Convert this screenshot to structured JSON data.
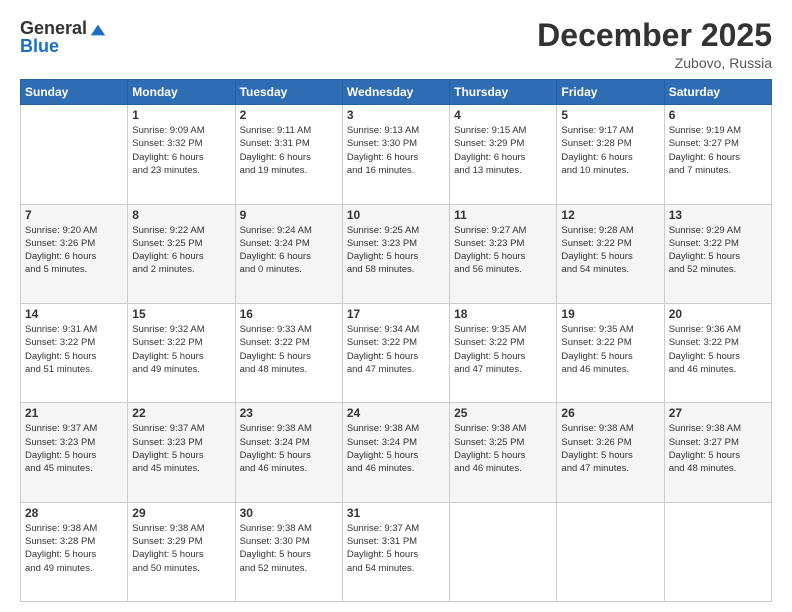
{
  "header": {
    "logo_general": "General",
    "logo_blue": "Blue",
    "month": "December 2025",
    "location": "Zubovo, Russia"
  },
  "days_of_week": [
    "Sunday",
    "Monday",
    "Tuesday",
    "Wednesday",
    "Thursday",
    "Friday",
    "Saturday"
  ],
  "weeks": [
    [
      {
        "day": "",
        "info": ""
      },
      {
        "day": "1",
        "info": "Sunrise: 9:09 AM\nSunset: 3:32 PM\nDaylight: 6 hours\nand 23 minutes."
      },
      {
        "day": "2",
        "info": "Sunrise: 9:11 AM\nSunset: 3:31 PM\nDaylight: 6 hours\nand 19 minutes."
      },
      {
        "day": "3",
        "info": "Sunrise: 9:13 AM\nSunset: 3:30 PM\nDaylight: 6 hours\nand 16 minutes."
      },
      {
        "day": "4",
        "info": "Sunrise: 9:15 AM\nSunset: 3:29 PM\nDaylight: 6 hours\nand 13 minutes."
      },
      {
        "day": "5",
        "info": "Sunrise: 9:17 AM\nSunset: 3:28 PM\nDaylight: 6 hours\nand 10 minutes."
      },
      {
        "day": "6",
        "info": "Sunrise: 9:19 AM\nSunset: 3:27 PM\nDaylight: 6 hours\nand 7 minutes."
      }
    ],
    [
      {
        "day": "7",
        "info": "Sunrise: 9:20 AM\nSunset: 3:26 PM\nDaylight: 6 hours\nand 5 minutes."
      },
      {
        "day": "8",
        "info": "Sunrise: 9:22 AM\nSunset: 3:25 PM\nDaylight: 6 hours\nand 2 minutes."
      },
      {
        "day": "9",
        "info": "Sunrise: 9:24 AM\nSunset: 3:24 PM\nDaylight: 6 hours\nand 0 minutes."
      },
      {
        "day": "10",
        "info": "Sunrise: 9:25 AM\nSunset: 3:23 PM\nDaylight: 5 hours\nand 58 minutes."
      },
      {
        "day": "11",
        "info": "Sunrise: 9:27 AM\nSunset: 3:23 PM\nDaylight: 5 hours\nand 56 minutes."
      },
      {
        "day": "12",
        "info": "Sunrise: 9:28 AM\nSunset: 3:22 PM\nDaylight: 5 hours\nand 54 minutes."
      },
      {
        "day": "13",
        "info": "Sunrise: 9:29 AM\nSunset: 3:22 PM\nDaylight: 5 hours\nand 52 minutes."
      }
    ],
    [
      {
        "day": "14",
        "info": "Sunrise: 9:31 AM\nSunset: 3:22 PM\nDaylight: 5 hours\nand 51 minutes."
      },
      {
        "day": "15",
        "info": "Sunrise: 9:32 AM\nSunset: 3:22 PM\nDaylight: 5 hours\nand 49 minutes."
      },
      {
        "day": "16",
        "info": "Sunrise: 9:33 AM\nSunset: 3:22 PM\nDaylight: 5 hours\nand 48 minutes."
      },
      {
        "day": "17",
        "info": "Sunrise: 9:34 AM\nSunset: 3:22 PM\nDaylight: 5 hours\nand 47 minutes."
      },
      {
        "day": "18",
        "info": "Sunrise: 9:35 AM\nSunset: 3:22 PM\nDaylight: 5 hours\nand 47 minutes."
      },
      {
        "day": "19",
        "info": "Sunrise: 9:35 AM\nSunset: 3:22 PM\nDaylight: 5 hours\nand 46 minutes."
      },
      {
        "day": "20",
        "info": "Sunrise: 9:36 AM\nSunset: 3:22 PM\nDaylight: 5 hours\nand 46 minutes."
      }
    ],
    [
      {
        "day": "21",
        "info": "Sunrise: 9:37 AM\nSunset: 3:23 PM\nDaylight: 5 hours\nand 45 minutes."
      },
      {
        "day": "22",
        "info": "Sunrise: 9:37 AM\nSunset: 3:23 PM\nDaylight: 5 hours\nand 45 minutes."
      },
      {
        "day": "23",
        "info": "Sunrise: 9:38 AM\nSunset: 3:24 PM\nDaylight: 5 hours\nand 46 minutes."
      },
      {
        "day": "24",
        "info": "Sunrise: 9:38 AM\nSunset: 3:24 PM\nDaylight: 5 hours\nand 46 minutes."
      },
      {
        "day": "25",
        "info": "Sunrise: 9:38 AM\nSunset: 3:25 PM\nDaylight: 5 hours\nand 46 minutes."
      },
      {
        "day": "26",
        "info": "Sunrise: 9:38 AM\nSunset: 3:26 PM\nDaylight: 5 hours\nand 47 minutes."
      },
      {
        "day": "27",
        "info": "Sunrise: 9:38 AM\nSunset: 3:27 PM\nDaylight: 5 hours\nand 48 minutes."
      }
    ],
    [
      {
        "day": "28",
        "info": "Sunrise: 9:38 AM\nSunset: 3:28 PM\nDaylight: 5 hours\nand 49 minutes."
      },
      {
        "day": "29",
        "info": "Sunrise: 9:38 AM\nSunset: 3:29 PM\nDaylight: 5 hours\nand 50 minutes."
      },
      {
        "day": "30",
        "info": "Sunrise: 9:38 AM\nSunset: 3:30 PM\nDaylight: 5 hours\nand 52 minutes."
      },
      {
        "day": "31",
        "info": "Sunrise: 9:37 AM\nSunset: 3:31 PM\nDaylight: 5 hours\nand 54 minutes."
      },
      {
        "day": "",
        "info": ""
      },
      {
        "day": "",
        "info": ""
      },
      {
        "day": "",
        "info": ""
      }
    ]
  ]
}
